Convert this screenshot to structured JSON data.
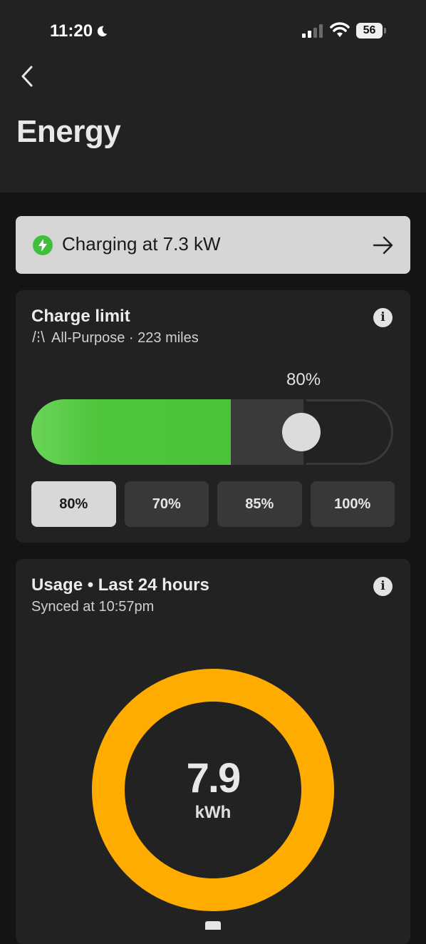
{
  "status_bar": {
    "time": "11:20",
    "battery": "56"
  },
  "header": {
    "title": "Energy"
  },
  "charging_banner": {
    "label": "Charging at 7.3 kW"
  },
  "charge_limit": {
    "title": "Charge limit",
    "mode": "All-Purpose · 223 miles",
    "current_percent_label": "80%",
    "current_limit_fraction": 0.8,
    "charge_level_fraction": 0.55,
    "presets": [
      "80%",
      "70%",
      "85%",
      "100%"
    ],
    "selected_preset": "80%"
  },
  "usage": {
    "title": "Usage  •  Last 24 hours",
    "synced": "Synced at 10:57pm",
    "total_value": "7.9",
    "total_unit": "kWh"
  },
  "colors": {
    "charging_green": "#4dc33a",
    "usage_orange": "#ffac00",
    "background": "#141414",
    "card": "#222222"
  },
  "icons": [
    "moon-icon",
    "signal-icon",
    "wifi-icon",
    "back-chevron-icon",
    "bolt-icon",
    "arrow-right-icon",
    "info-icon",
    "road-icon"
  ]
}
